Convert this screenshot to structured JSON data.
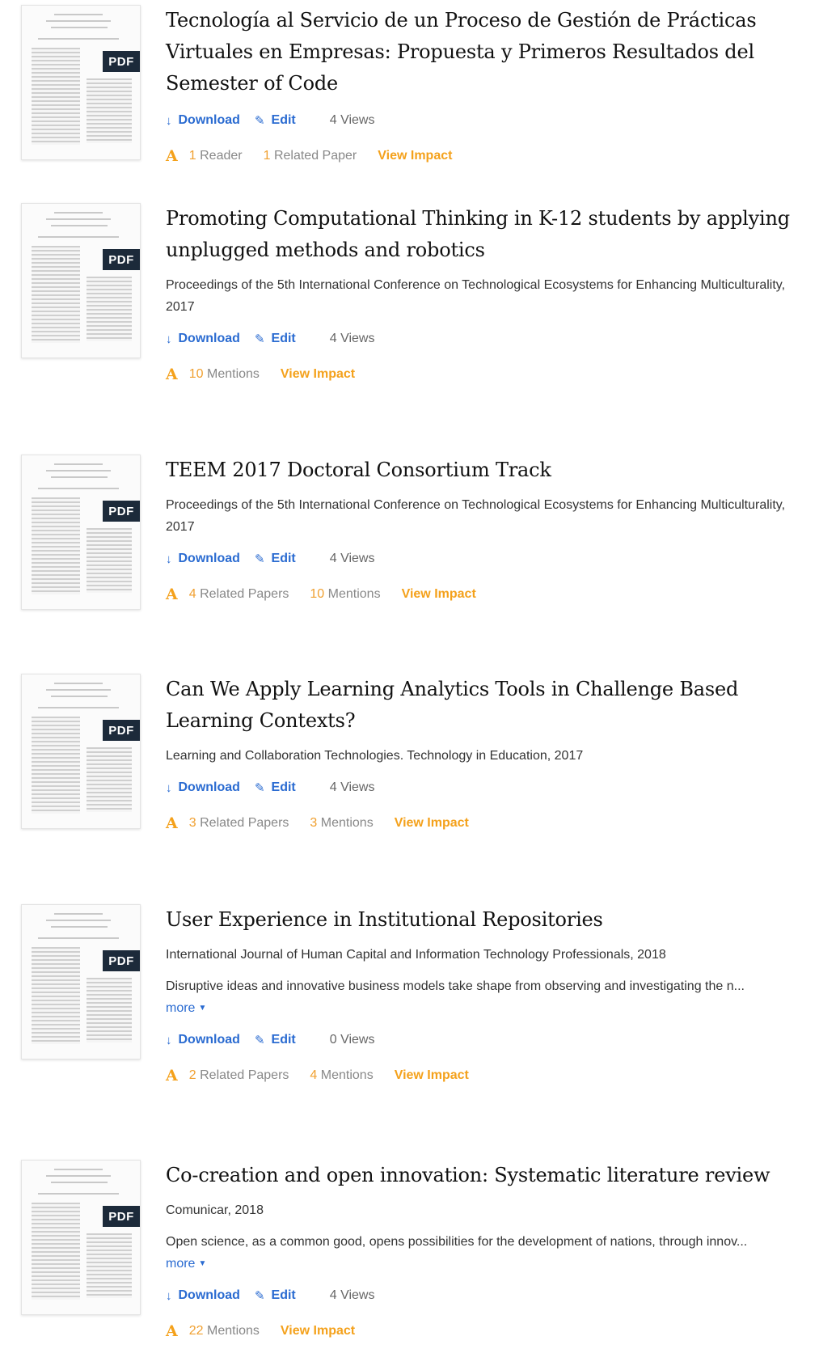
{
  "pdf_label": "PDF",
  "download_label": "Download",
  "edit_label": "Edit",
  "view_impact_label": "View Impact",
  "more_label": "more",
  "papers": [
    {
      "title": "Tecnología al Servicio de un Proceso de Gestión de Prácticas Virtuales en Empresas: Propuesta y Primeros Resultados del Semester of Code",
      "meta": "",
      "abstract": "",
      "views": "4 Views",
      "stats": [
        {
          "num": "1",
          "label": "Reader"
        },
        {
          "num": "1",
          "label": "Related Paper"
        }
      ]
    },
    {
      "title": "Promoting Computational Thinking in K-12 students by applying unplugged methods and robotics",
      "meta": "Proceedings of the 5th International Conference on Technological Ecosystems for Enhancing Multiculturality, 2017",
      "abstract": "",
      "views": "4 Views",
      "stats": [
        {
          "num": "10",
          "label": "Mentions"
        }
      ]
    },
    {
      "title": "TEEM 2017 Doctoral Consortium Track",
      "meta": "Proceedings of the 5th International Conference on Technological Ecosystems for Enhancing Multiculturality, 2017",
      "abstract": "",
      "views": "4 Views",
      "stats": [
        {
          "num": "4",
          "label": "Related Papers"
        },
        {
          "num": "10",
          "label": "Mentions"
        }
      ]
    },
    {
      "title": "Can We Apply Learning Analytics Tools in Challenge Based Learning Contexts?",
      "meta": "Learning and Collaboration Technologies. Technology in Education, 2017",
      "abstract": "",
      "views": "4 Views",
      "stats": [
        {
          "num": "3",
          "label": "Related Papers"
        },
        {
          "num": "3",
          "label": "Mentions"
        }
      ]
    },
    {
      "title": "User Experience in Institutional Repositories",
      "meta": "International Journal of Human Capital and Information Technology Professionals, 2018",
      "abstract": "Disruptive ideas and innovative business models take shape from observing and investigating the n...",
      "views": "0 Views",
      "stats": [
        {
          "num": "2",
          "label": "Related Papers"
        },
        {
          "num": "4",
          "label": "Mentions"
        }
      ]
    },
    {
      "title": "Co-creation and open innovation: Systematic literature review",
      "meta": "Comunicar, 2018",
      "abstract": "Open science, as a common good, opens possibilities for the development of nations, through innov...",
      "views": "4 Views",
      "stats": [
        {
          "num": "22",
          "label": "Mentions"
        }
      ]
    }
  ]
}
